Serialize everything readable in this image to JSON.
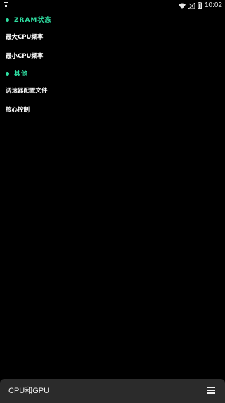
{
  "status_bar": {
    "time": "10:02",
    "icons": [
      "notification-icon",
      "wifi-icon",
      "signal-icon",
      "battery-icon"
    ]
  },
  "sections": [
    {
      "title": "ZRAM状态",
      "items": [
        {
          "label": "最大CPU频率"
        },
        {
          "label": "最小CPU频率"
        }
      ]
    },
    {
      "title": "其他",
      "items": [
        {
          "label": "调速器配置文件"
        },
        {
          "label": "核心控制"
        }
      ]
    }
  ],
  "bottom_bar": {
    "title": "CPU和GPU",
    "menu_icon": "hamburger-menu-icon"
  },
  "colors": {
    "background": "#000000",
    "accent": "#2fe0a3",
    "text": "#ffffff",
    "bottom_bar": "#2b2b2b"
  }
}
